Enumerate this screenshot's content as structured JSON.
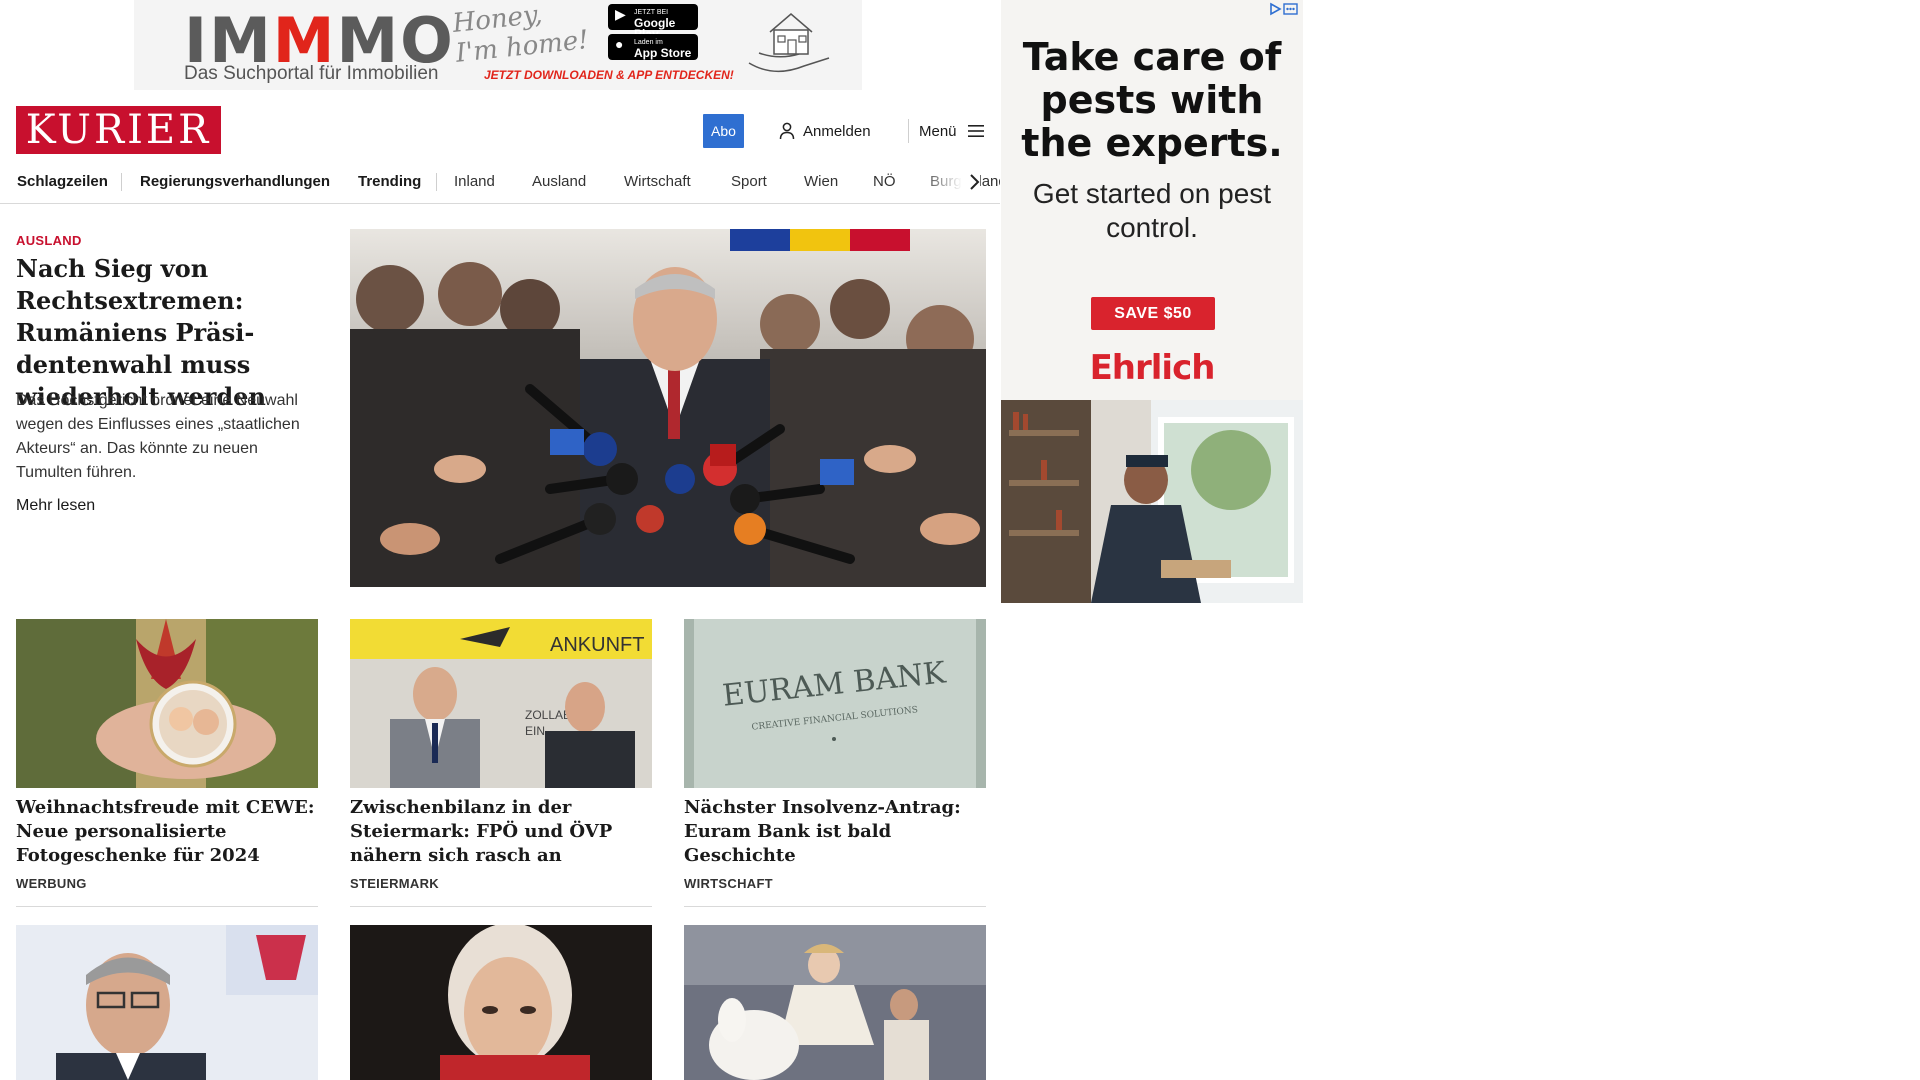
{
  "top_ad": {
    "brand_pre": "IM",
    "brand_mid": "M",
    "brand_post": "MO",
    "tagline": "Das Suchportal für Immobilien",
    "script_line1": "Honey,",
    "script_line2": "I'm home!",
    "google_play_small": "JETZT BEI",
    "google_play": "Google Play",
    "app_store_small": "Laden im",
    "app_store": "App Store",
    "cta": "JETZT DOWNLOADEN & APP ENTDECKEN!"
  },
  "header": {
    "logo": "KURIER",
    "abo": "Abo",
    "login": "Anmelden",
    "menu": "Menü"
  },
  "nav": {
    "items": [
      "Schlagzeilen",
      "Regierungsverhandlungen",
      "Trending",
      "Inland",
      "Ausland",
      "Wirtschaft",
      "Sport",
      "Wien",
      "NÖ",
      "Burgenland"
    ]
  },
  "lead": {
    "kicker": "AUSLAND",
    "title": "Nach Sieg von Rechtsex­tremen: Rumäniens Präsi­dentenwahl muss wieder­holt werden",
    "teaser": "Das Höchstgericht ordnet eine Neuwahl wegen des Einflusses eines „staatlichen Akteurs“ an. Das könnte zu neuen Tumulten führen.",
    "more": "Mehr lesen"
  },
  "cards": [
    {
      "title": "Weihnachtsfreude mit CEWE: Neue personalisierte Fotogeschenke für 2024",
      "category": "WERBUNG"
    },
    {
      "title": "Zwischenbilanz in der Steiermark: FPÖ und ÖVP nähern sich rasch an",
      "category": "STEIERMARK",
      "sign_text": "ANKUNFT",
      "sign_sub1": "ZOLLAB",
      "sign_sub2": "EIN"
    },
    {
      "title": "Nächster Insolvenz-Antrag: Euram Bank ist bald Geschichte",
      "category": "WIRTSCHAFT",
      "plaque_text": "EURAM BANK",
      "plaque_sub": "CREATIVE FINANCIAL SOLUTIONS"
    }
  ],
  "side_ad": {
    "headline": "Take care of pests with the experts.",
    "sub": "Get started on pest control.",
    "button": "SAVE $50",
    "brand": "Ehrlich"
  },
  "colors": {
    "brand_red": "#c8102e",
    "abo_blue": "#2f6fd1",
    "ad_red": "#d9232d"
  }
}
